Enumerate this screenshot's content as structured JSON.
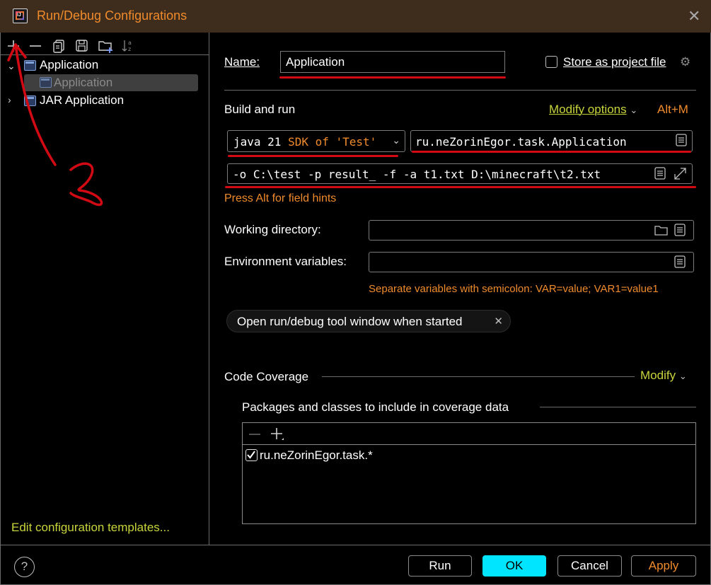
{
  "window": {
    "title": "Run/Debug Configurations"
  },
  "left": {
    "toolbar": [
      "add-icon",
      "remove-icon",
      "copy-icon",
      "save-icon",
      "new-folder-icon",
      "sort-icon"
    ],
    "tree": [
      {
        "label": "Application",
        "expanded": true,
        "children": [
          {
            "label": "Application"
          }
        ]
      },
      {
        "label": "JAR Application",
        "expanded": false
      }
    ],
    "edit_templates": "Edit configuration templates..."
  },
  "form": {
    "name_label": "Name:",
    "name_value": "Application",
    "store_label": "Store as project file",
    "build_run": "Build and run",
    "modify_options": "Modify options",
    "modify_shortcut": "Alt+M",
    "jdk_prefix": "java 21",
    "jdk_suffix": "SDK of 'Test'",
    "main_class": "ru.neZorinEgor.task.Application",
    "program_args": "-o C:\\test -p result_ -f -a t1.txt D:\\minecraft\\t2.txt",
    "field_hint": "Press Alt for field hints",
    "working_dir_label": "Working directory:",
    "working_dir_value": "",
    "env_label": "Environment variables:",
    "env_value": "",
    "env_hint": "Separate variables with semicolon: VAR=value; VAR1=value1",
    "chip_label": "Open run/debug tool window when started",
    "coverage_title": "Code Coverage",
    "coverage_modify": "Modify",
    "coverage_include": "Packages and classes to include in coverage data",
    "coverage_items": [
      {
        "label": "ru.neZorinEgor.task.*",
        "checked": true
      }
    ]
  },
  "buttons": {
    "run": "Run",
    "ok": "OK",
    "cancel": "Cancel",
    "apply": "Apply"
  },
  "colors": {
    "accent_orange": "#f08b2c",
    "accent_link": "#c8d43c",
    "ok_bg": "#00e5ff",
    "annotation_red": "#d10a14",
    "titlebar": "#3e2c1c"
  }
}
